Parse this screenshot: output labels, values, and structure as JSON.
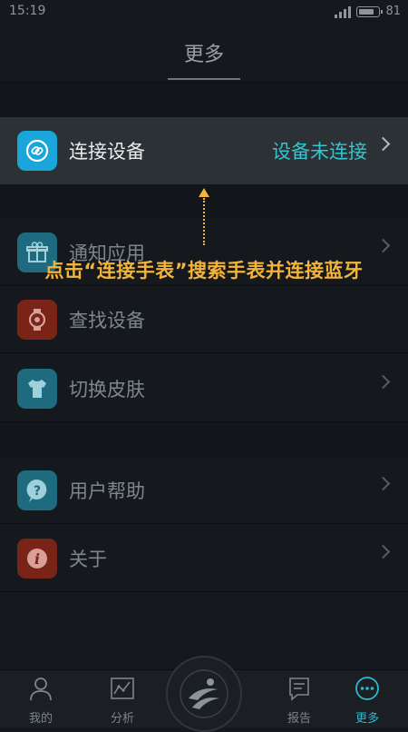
{
  "status_bar": {
    "time": "15:19",
    "battery": "81",
    "battery_level": 0.81
  },
  "header": {
    "title": "更多"
  },
  "rows": [
    {
      "label": "连接设备",
      "value": "设备未连接",
      "icon": "link-watch-icon",
      "color": "#1aa6d8"
    },
    {
      "label": "通知应用",
      "icon": "gift-icon",
      "color": "#1e6b80"
    },
    {
      "label": "查找设备",
      "icon": "watch-search-icon",
      "color": "#7a2418"
    },
    {
      "label": "切换皮肤",
      "icon": "tshirt-icon",
      "color": "#1e6b80"
    },
    {
      "label": "用户帮助",
      "icon": "question-icon",
      "color": "#1e6b80"
    },
    {
      "label": "关于",
      "icon": "info-icon",
      "color": "#7a2418"
    }
  ],
  "annotation": {
    "text": "点击“连接手表”搜索手表并连接蓝牙"
  },
  "tabbar": {
    "tabs": [
      {
        "label": "我的",
        "icon": "person-icon"
      },
      {
        "label": "分析",
        "icon": "chart-icon"
      },
      {
        "label": "报告",
        "icon": "report-icon"
      },
      {
        "label": "更多",
        "icon": "more-icon",
        "active": true
      }
    ],
    "center_icon": "logo-icon"
  },
  "colors": {
    "accent": "#2cb7d3",
    "annotation": "#f4b43a"
  }
}
